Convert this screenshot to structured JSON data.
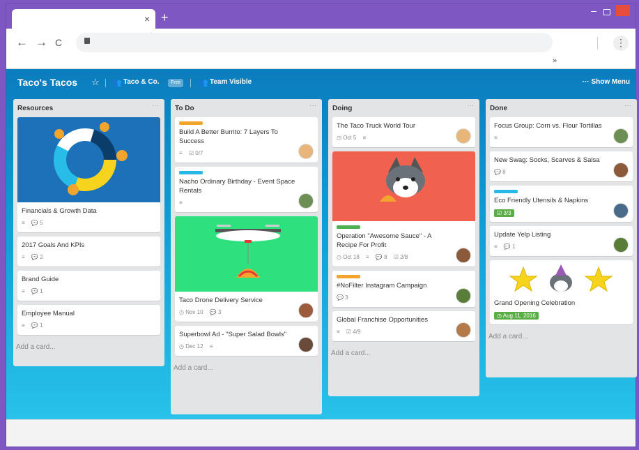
{
  "browser": {
    "tab_close": "×",
    "new_tab": "+",
    "back": "←",
    "forward": "→",
    "reload": "C",
    "bookmarks_more": "»",
    "menu": "⋮",
    "min": "–",
    "close": ""
  },
  "board": {
    "title": "Taco's Tacos",
    "org": "Taco & Co.",
    "org_badge": "Free",
    "visibility": "Team Visible",
    "show_menu": "Show Menu",
    "menu_dash": "···",
    "add_card": "Add a card..."
  },
  "lists": [
    {
      "title": "Resources",
      "cards": [
        {
          "title": "Financials & Growth Data",
          "badges": [
            "≡",
            "💬 5"
          ]
        },
        {
          "title": "2017 Goals And KPIs",
          "badges": [
            "≡",
            "💬 2"
          ]
        },
        {
          "title": "Brand Guide",
          "badges": [
            "≡",
            "💬 1"
          ]
        },
        {
          "title": "Employee Manual",
          "badges": [
            "≡",
            "💬 1"
          ]
        }
      ]
    },
    {
      "title": "To Do",
      "cards": [
        {
          "title": "Build A Better Burrito: 7 Layers To Success",
          "badges": [
            "≡",
            "☑ 0/7"
          ],
          "label": "#f2a42d"
        },
        {
          "title": "Nacho Ordinary Birthday - Event Space Rentals",
          "badges": [
            "≡"
          ],
          "label": "#29b7e5"
        },
        {
          "title": "Taco Drone Delivery Service",
          "badges": [
            "◷ Nov 10",
            "💬 3"
          ]
        },
        {
          "title": "Superbowl Ad - \"Super Salad Bowls\"",
          "badges": [
            "◷ Dec 12",
            "≡"
          ]
        }
      ]
    },
    {
      "title": "Doing",
      "cards": [
        {
          "title": "The Taco Truck World Tour",
          "badges": [
            "◷ Oct 5",
            "≡"
          ]
        },
        {
          "title": "Operation \"Awesome Sauce\" - A Recipe For Profit",
          "badges": [
            "◷ Oct 18",
            "≡",
            "💬 8",
            "☑ 2/8"
          ],
          "label": "#4caf50"
        },
        {
          "title": "#NoFilter Instagram Campaign",
          "badges": [
            "💬 3"
          ],
          "label": "#f2a42d"
        },
        {
          "title": "Global Franchise Opportunities",
          "badges": [
            "≡",
            "☑ 4/9"
          ]
        }
      ]
    },
    {
      "title": "Done",
      "cards": [
        {
          "title": "Focus Group: Corn vs. Flour Tortillas",
          "badges": [
            "≡"
          ]
        },
        {
          "title": "New Swag: Socks, Scarves & Salsa",
          "badges": [
            "💬 8"
          ]
        },
        {
          "title": "Eco Friendly Utensils & Napkins",
          "badges": [
            "☑ 3/3"
          ],
          "label": "#29b7e5"
        },
        {
          "title": "Update Yelp Listing",
          "badges": [
            "≡",
            "💬 1"
          ]
        },
        {
          "title": "Grand Opening Celebration",
          "badges": [
            "◷ Aug 11, 2016"
          ]
        }
      ]
    }
  ],
  "colors": {
    "window_frame": "#7e57c2",
    "board_top": "#0b7cbd",
    "board_bottom": "#28c2ea",
    "complete_green": "#5aac44"
  }
}
